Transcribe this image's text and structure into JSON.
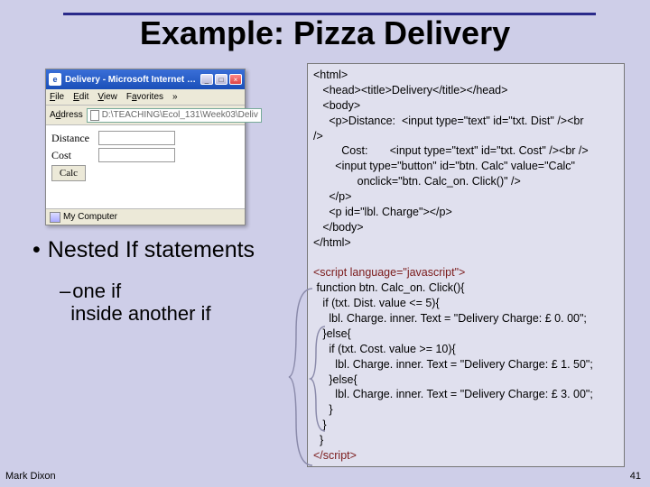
{
  "title": "Example: Pizza Delivery",
  "screenshot": {
    "window_title": "Delivery - Microsoft Internet …",
    "menu": {
      "file": "File",
      "edit": "Edit",
      "view": "View",
      "favorites": "Favorites",
      "more": "»"
    },
    "address_label": "Address",
    "address_value": "D:\\TEACHING\\Ecol_131\\Week03\\Deliv",
    "fields": {
      "distance": "Distance",
      "cost": "Cost",
      "calc": "Calc"
    },
    "status": "My Computer"
  },
  "bullets": {
    "main": "Nested If statements",
    "sub_l1": "one if",
    "sub_l2": "inside another if"
  },
  "code_html_lines": [
    "<html>",
    "   <head><title>Delivery</title></head>",
    "   <body>",
    "     <p>Distance:  <input type=\"text\" id=\"txt. Dist\" /><br",
    "/>",
    "         Cost:       <input type=\"text\" id=\"txt. Cost\" /><br />",
    "       <input type=\"button\" id=\"btn. Calc\" value=\"Calc\"",
    "              onclick=\"btn. Calc_on. Click()\" />",
    "     </p>",
    "     <p id=\"lbl. Charge\"></p>",
    "   </body>",
    "</html>"
  ],
  "code_script_open": "<script language=\"javascript\">",
  "code_script_lines": [
    " function btn. Calc_on. Click(){",
    "   if (txt. Dist. value <= 5){",
    "     lbl. Charge. inner. Text = \"Delivery Charge: £ 0. 00\";",
    "   }else{",
    "     if (txt. Cost. value >= 10){",
    "       lbl. Charge. inner. Text = \"Delivery Charge: £ 1. 50\";",
    "     }else{",
    "       lbl. Charge. inner. Text = \"Delivery Charge: £ 3. 00\";",
    "     }",
    "   }",
    "  }"
  ],
  "code_script_close": "</script>",
  "footer": {
    "left": "Mark Dixon",
    "right": "41"
  }
}
